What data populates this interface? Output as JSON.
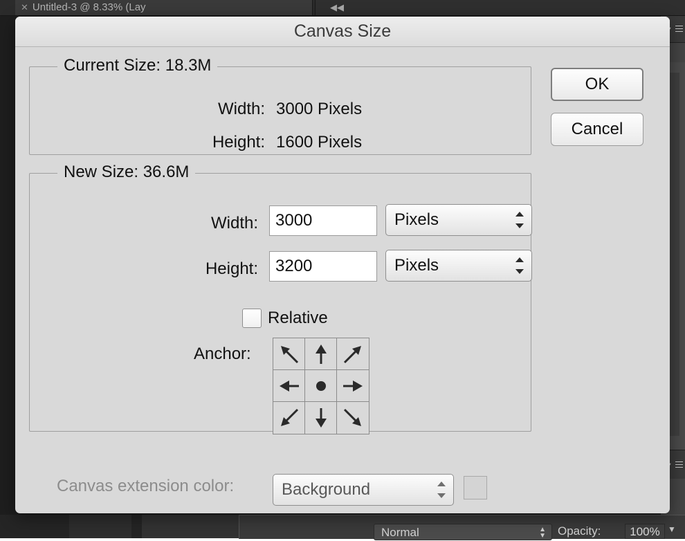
{
  "app": {
    "document_tab": {
      "close_icon": "close-icon",
      "title": "Untitled-3 @ 8.33% (Lay"
    },
    "collapse_panels_icon": "◀◀",
    "layers_panel": {
      "blend_mode": "Normal",
      "opacity_label": "Opacity:",
      "opacity_value": "100%"
    }
  },
  "dialog": {
    "title": "Canvas Size",
    "current_size": {
      "legend": "Current Size: 18.3M",
      "rows": [
        {
          "label": "Width:",
          "value": "3000 Pixels"
        },
        {
          "label": "Height:",
          "value": "1600 Pixels"
        }
      ]
    },
    "new_size": {
      "legend": "New Size: 36.6M",
      "width": {
        "label": "Width:",
        "value": "3000",
        "unit": "Pixels"
      },
      "height": {
        "label": "Height:",
        "value": "3200",
        "unit": "Pixels"
      },
      "relative": {
        "label": "Relative",
        "checked": false
      },
      "anchor": {
        "label": "Anchor:",
        "selected": "center",
        "cells": [
          "arrow-up-left-icon",
          "arrow-up-icon",
          "arrow-up-right-icon",
          "arrow-left-icon",
          "anchor-center-dot-icon",
          "arrow-right-icon",
          "arrow-down-left-icon",
          "arrow-down-icon",
          "arrow-down-right-icon"
        ]
      }
    },
    "extension_color": {
      "label": "Canvas extension color:",
      "value": "Background",
      "swatch_color": "#d4d4d4",
      "disabled": true
    },
    "buttons": {
      "ok": "OK",
      "cancel": "Cancel"
    }
  },
  "colors": {
    "dialog_background": "#d9d9d9",
    "titlebar_top": "#ededed",
    "titlebar_bottom": "#dcdcdc",
    "app_background": "#1e1e1e",
    "panel_background": "#3a3a3a"
  }
}
